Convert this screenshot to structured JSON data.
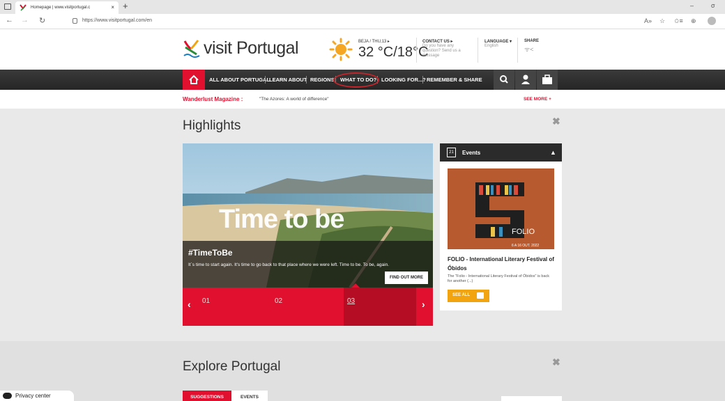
{
  "browser": {
    "tab_title": "Homepage | www.visitportugal.c",
    "tab_close": "×",
    "new_tab": "+",
    "url": "https://www.visitportugal.com/en",
    "minimize": "–",
    "restore": "σ"
  },
  "header": {
    "brand": "visit Portugal",
    "weather_city": "BEJA / THU,13 ▸",
    "weather_temp": "32 °C/18°C",
    "contact_title": "CONTACT US ▸",
    "contact_sub": "Do you have any question? Send us a message",
    "language_title": "LANGUAGE ▾",
    "language_value": "English",
    "share_title": "SHARE"
  },
  "nav": {
    "items": [
      "ALL ABOUT PORTUGAL",
      "LEARN ABOUT",
      "REGIONS",
      "WHAT TO DO?",
      "LOOKING FOR...?",
      "REMEMBER & SHARE"
    ]
  },
  "news": {
    "title": "Wanderlust Magazine :",
    "text": "\"The Azores: A world of difference\"",
    "see_more": "SEE MORE +"
  },
  "highlights": {
    "title": "Highlights",
    "slide_headline": "Time to be",
    "slide_title": "#TimeToBe",
    "slide_text": "It´s time to start again. It's time to go back to that place where we were left. Time to be. To be, again.",
    "find_out_more": "FIND OUT MORE",
    "slides": [
      "01",
      "02",
      "03"
    ],
    "active_slide": 3
  },
  "events": {
    "title": "Events",
    "calendar_day": "21",
    "poster_title": "FOLIO",
    "poster_date": "6 A 16 OUT. 2022",
    "event_name": "FOLIO - International Literary Festival of Óbidos",
    "event_desc": "The \"Folio - International Literary Festival of Óbidos\" is back for another (...)",
    "see_all": "SEE ALL"
  },
  "explore": {
    "title": "Explore Portugal",
    "tabs": [
      "SUGGESTIONS",
      "EVENTS"
    ]
  },
  "privacy": {
    "label": "Privacy center"
  },
  "colors": {
    "brand_red": "#e2102f",
    "nav_dark": "#2b2b2b",
    "accent_orange": "#f1a40f"
  }
}
